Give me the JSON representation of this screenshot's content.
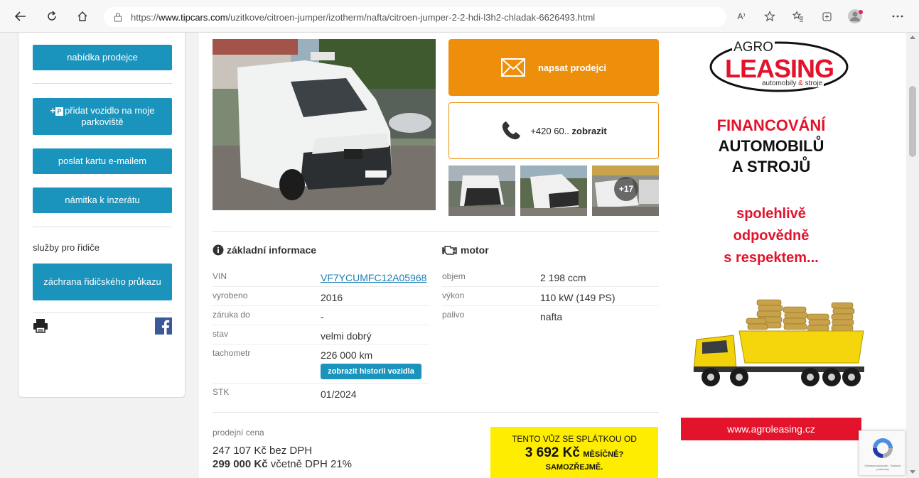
{
  "browser": {
    "url_prefix": "https://",
    "url_domain": "www.tipcars.com",
    "url_path": "/uzitkove/citroen-jumper/izotherm/nafta/citroen-jumper-2-2-hdi-l3h2-chladak-6626493.html",
    "read_aloud": "A⁾"
  },
  "sidebar": {
    "btn_offer": "nabídka prodejce",
    "btn_add_badge": "P",
    "btn_add": "přidat vozidlo na moje parkoviště",
    "btn_email": "poslat kartu e-mailem",
    "btn_report": "námitka k inzerátu",
    "services_label": "služby pro řidiče",
    "btn_rescue": "záchrana řidičského průkazu"
  },
  "contact": {
    "message": "napsat prodejci",
    "phone_prefix": "+420 60..",
    "phone_show": "zobrazit",
    "more_photos": "+17"
  },
  "basic": {
    "title": "základní informace",
    "rows": [
      {
        "label": "VIN",
        "value": "VF7YCUMFC12A05968"
      },
      {
        "label": "vyrobeno",
        "value": "2016"
      },
      {
        "label": "záruka do",
        "value": "-"
      },
      {
        "label": "stav",
        "value": "velmi dobrý"
      },
      {
        "label": "tachometr",
        "value": "226 000 km"
      },
      {
        "label": "STK",
        "value": "01/2024"
      }
    ],
    "history_button": "zobrazit historii vozidla"
  },
  "motor": {
    "title": "motor",
    "rows": [
      {
        "label": "objem",
        "value": "2 198 ccm"
      },
      {
        "label": "výkon",
        "value": "110 kW (149 PS)"
      },
      {
        "label": "palivo",
        "value": "nafta"
      }
    ]
  },
  "price": {
    "label": "prodejní cena",
    "net": "247 107 Kč bez DPH",
    "gross_amount": "299 000 Kč",
    "gross_suffix": "včetně DPH 21%",
    "promo_line1": "TENTO VŮZ SE SPLÁTKOU OD",
    "promo_amount": "3 692 Kč",
    "promo_per": "MĚSÍČNĚ?",
    "promo_line3": "SAMOZŘEJMĚ."
  },
  "ad": {
    "brand_top": "AGRO",
    "brand_main": "LEASING",
    "brand_sub_a": "automobily",
    "brand_sub_amp": "&",
    "brand_sub_b": "stroje",
    "line1": "FINANCOVÁNÍ",
    "line2": "AUTOMOBILŮ",
    "line3": "A STROJŮ",
    "slogan1": "spolehlivě",
    "slogan2": "odpovědně",
    "slogan3": "s respektem...",
    "url": "www.agroleasing.cz"
  },
  "recaptcha": {
    "text": "Ochrana soukromí - Smluvní podmínky"
  },
  "colors": {
    "accent_blue": "#1a94bd",
    "orange": "#ee8f0c",
    "promo_yellow": "#ffed00",
    "ad_red": "#e3132c"
  }
}
